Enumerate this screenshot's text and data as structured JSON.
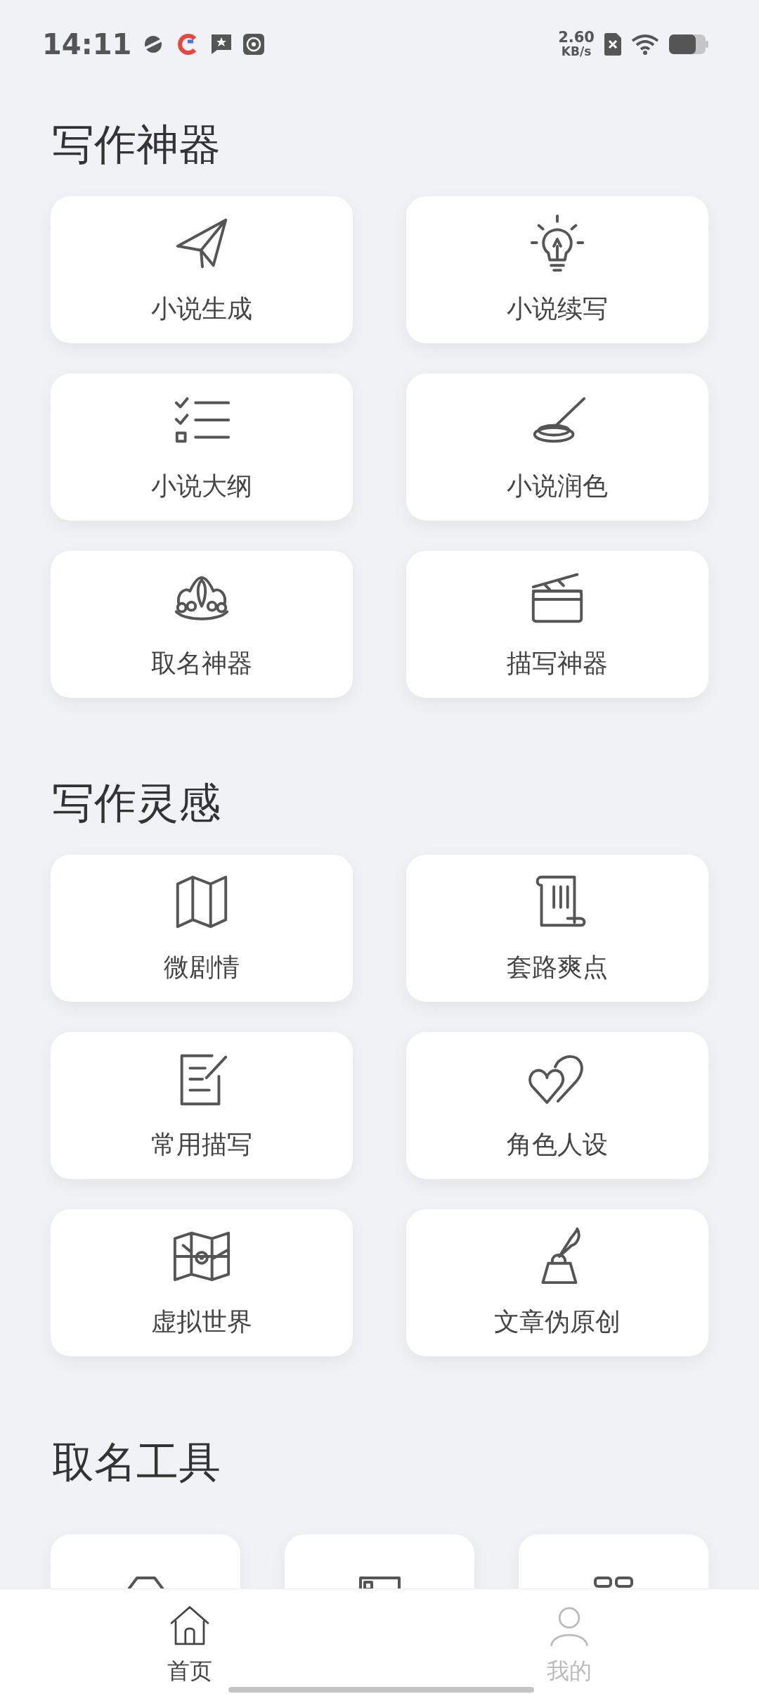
{
  "status_bar": {
    "time": "14:11",
    "net_speed": "2.60",
    "net_unit": "KB/s"
  },
  "sections": [
    {
      "title": "写作神器",
      "kind": "pairs",
      "items": [
        {
          "label": "小说生成",
          "kind": "plane"
        },
        {
          "label": "小说续写",
          "kind": "bulb"
        },
        {
          "label": "小说大纲",
          "kind": "checklist"
        },
        {
          "label": "小说润色",
          "kind": "brush"
        },
        {
          "label": "取名神器",
          "kind": "crown"
        },
        {
          "label": "描写神器",
          "kind": "clapper"
        }
      ]
    },
    {
      "title": "写作灵感",
      "kind": "pairs",
      "items": [
        {
          "label": "微剧情",
          "kind": "map"
        },
        {
          "label": "套路爽点",
          "kind": "scroll"
        },
        {
          "label": "常用描写",
          "kind": "note"
        },
        {
          "label": "角色人设",
          "kind": "hearts"
        },
        {
          "label": "虚拟世界",
          "kind": "worldmap"
        },
        {
          "label": "文章伪原创",
          "kind": "quill"
        }
      ]
    },
    {
      "title": "取名工具",
      "kind": "triples",
      "items": [
        {
          "kind": "tag"
        },
        {
          "kind": "frame"
        },
        {
          "kind": "blocks"
        }
      ]
    }
  ],
  "nav": [
    {
      "label": "首页",
      "kind": "home",
      "selected": true
    },
    {
      "label": "我的",
      "kind": "person",
      "selected": false
    }
  ]
}
